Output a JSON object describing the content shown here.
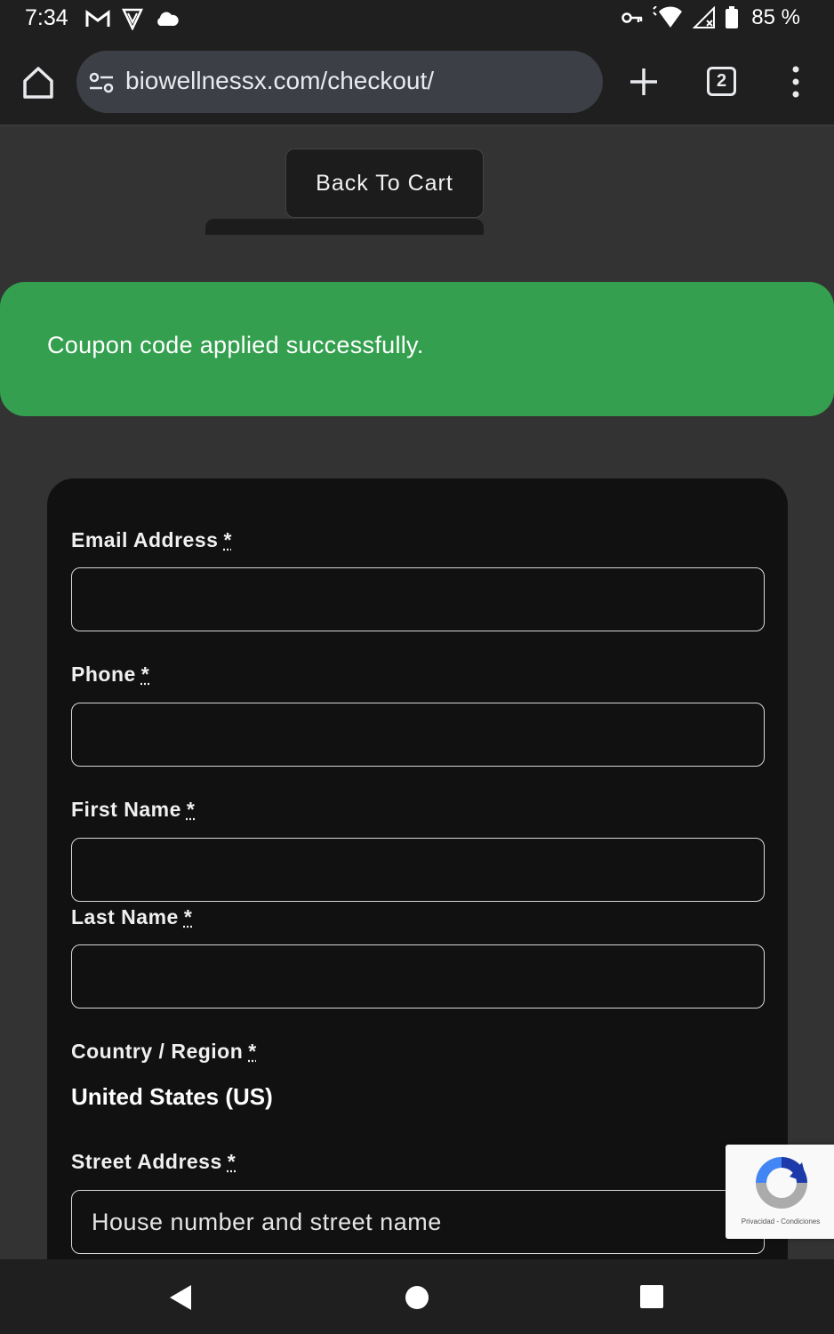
{
  "status_bar": {
    "time": "7:34",
    "left_icons": [
      "gmail-icon",
      "vpn-shield-icon",
      "cloud-icon"
    ],
    "right_icons": [
      "vpn-key-icon",
      "wifi-icon",
      "signal-icon",
      "battery-icon"
    ],
    "battery": "85 %"
  },
  "browser": {
    "url": "biowellnessx.com/checkout/",
    "tab_count": "2"
  },
  "page": {
    "back_to_cart": "Back To Cart",
    "notice": "Coupon code applied successfully.",
    "required_mark": "*"
  },
  "form": {
    "email_label": "Email Address",
    "email_value": "",
    "phone_label": "Phone",
    "phone_value": "",
    "first_name_label": "First Name",
    "first_name_value": "",
    "last_name_label": "Last Name",
    "last_name_value": "",
    "country_label": "Country / Region",
    "country_value": "United States (US)",
    "street_label": "Street Address",
    "street_placeholder": "House number and street name"
  },
  "recaptcha": {
    "links": "Privacidad - Condiciones"
  },
  "colors": {
    "page_bg": "#333333",
    "card_bg": "#111111",
    "success_green": "#34a04f",
    "toolbar_bg": "#1f1f1f"
  }
}
